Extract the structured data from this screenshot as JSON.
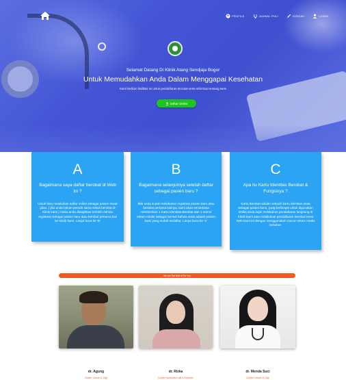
{
  "nav": {
    "home_icon": "home-icon",
    "links": [
      {
        "label": "Profile",
        "icon": "profile-icon"
      },
      {
        "label": "Jadwal Poli",
        "icon": "schedule-icon"
      },
      {
        "label": "Kontak",
        "icon": "pencil-icon"
      },
      {
        "label": "Login",
        "icon": "user-icon"
      }
    ]
  },
  "hero": {
    "welcome": "Selamat Datang Di Klinik Atang Sendjaja Bogor",
    "tagline": "Untuk Memudahkan Anda Dalam Menggapai Kesehatan",
    "subtext": "Kami berikan fasilitas ini untuk pendaftaran berobat serta informasi tentang kami",
    "cta_label": "Daftar Online"
  },
  "cards": [
    {
      "letter": "A",
      "title": "Bagaimana saya daftar berobat di Web ini ?",
      "body": "Untuk bisa melakukan daftar online sebagai pasien rawat jalan, ( jika anda belum pernah sama sekali berobat di Klinik kami ) maka anda diwajibkan terlebih dahulu registrasi sebagai pasien baru atau berobat pertama kali ke Klinik kami. Lanjut baca ke 'B'"
    },
    {
      "letter": "B",
      "title": "Bagaimana selanjutnya setelah daftar sebagai pasien baru ?",
      "body": "Bila anda sudah melakukan registrasi pasien baru atau berobat pertama kalinya, kami akan senantiasa memberikan 1 Kartu Identitas Berobat dan 1 nomor rekam medis sebagai bentuk bahwa anda adalah pasien kami yang sudah terdaftar. Lanjut baca ke 'C'"
    },
    {
      "letter": "C",
      "title": "Apa itu Kartu Identitas Berobat & Fungsinya ?",
      "body": "Kartu Berobat adalah sebuah kartu identitas anda sebagai pasien kami, yang berfungsi untuk digunakan ketika anda ingin melakukan pendaftaran langsung di Klinik kami atau melakukan pendaftaran berobat lewat Web kami ini dengan menggunakan nomor rekam medis tersebut."
    }
  ],
  "banner": "We Are The Best of For You",
  "doctors": [
    {
      "name": "dr. Agung",
      "role": "Dokter Umum & Gigi"
    },
    {
      "name": "dr. Rizka",
      "role": "Dokter Spesialis Kulit & Kelamin"
    },
    {
      "name": "dr. Menda Suci",
      "role": "Dokter Umum & Gigi"
    }
  ],
  "colors": {
    "hero": "#4456d6",
    "card": "#2ba4f3",
    "cta": "#1ec41e",
    "banner": "#f15b23"
  }
}
